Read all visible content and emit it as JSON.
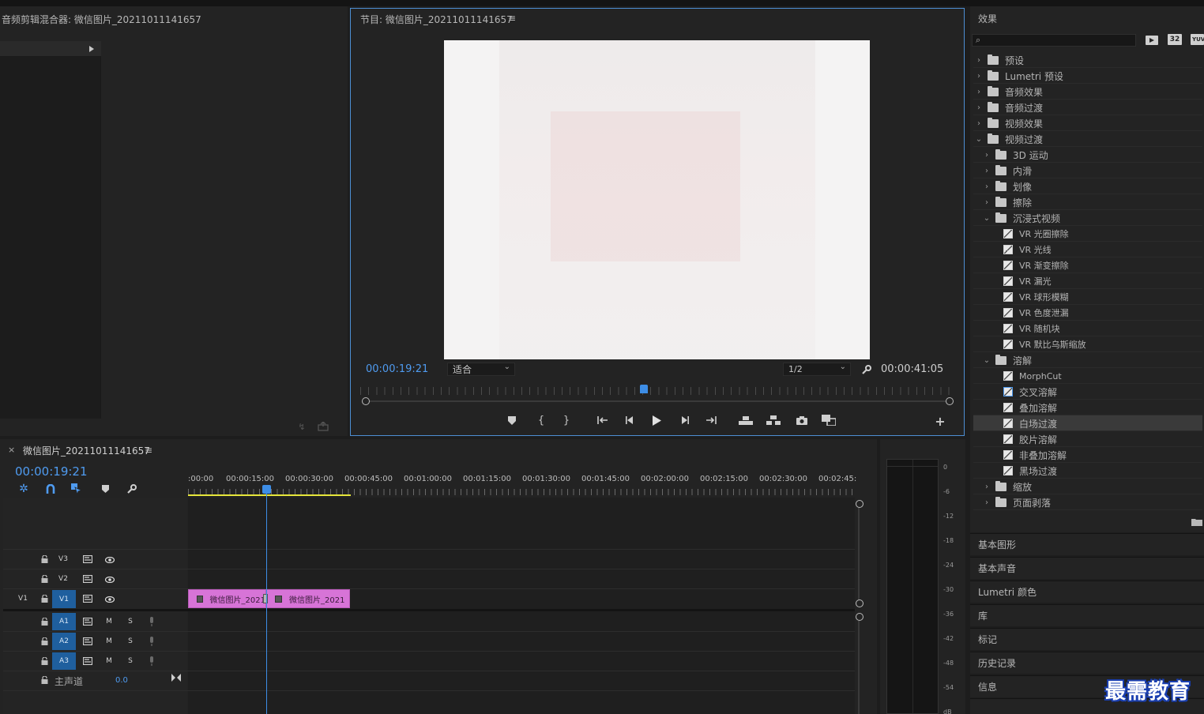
{
  "audio_mixer": {
    "title": "音频剪辑混合器: 微信图片_20211011141657"
  },
  "program": {
    "title": "节目: 微信图片_20211011141657",
    "timecode_current": "00:00:19:21",
    "fit_select": "适合",
    "resolution_select": "1/2",
    "timecode_duration": "00:00:41:05"
  },
  "effects": {
    "title": "效果",
    "search_placeholder": "",
    "badges": [
      "32",
      "YUV"
    ],
    "tree": [
      {
        "label": "预设",
        "kind": "preset",
        "level": 0,
        "chev": "›"
      },
      {
        "label": "Lumetri 预设",
        "kind": "preset",
        "level": 0,
        "chev": "›"
      },
      {
        "label": "音频效果",
        "kind": "folder",
        "level": 0,
        "chev": "›"
      },
      {
        "label": "音频过渡",
        "kind": "folder",
        "level": 0,
        "chev": "›"
      },
      {
        "label": "视频效果",
        "kind": "folder",
        "level": 0,
        "chev": "›"
      },
      {
        "label": "视频过渡",
        "kind": "folder",
        "level": 0,
        "chev": "⌄"
      },
      {
        "label": "3D 运动",
        "kind": "folder",
        "level": 1,
        "chev": "›"
      },
      {
        "label": "内滑",
        "kind": "folder",
        "level": 1,
        "chev": "›"
      },
      {
        "label": "划像",
        "kind": "folder",
        "level": 1,
        "chev": "›"
      },
      {
        "label": "擦除",
        "kind": "folder",
        "level": 1,
        "chev": "›"
      },
      {
        "label": "沉浸式视频",
        "kind": "folder",
        "level": 1,
        "chev": "⌄"
      },
      {
        "label": "VR 光圈擦除",
        "kind": "effect",
        "level": 2,
        "chev": ""
      },
      {
        "label": "VR 光线",
        "kind": "effect",
        "level": 2,
        "chev": ""
      },
      {
        "label": "VR 渐变擦除",
        "kind": "effect",
        "level": 2,
        "chev": ""
      },
      {
        "label": "VR 漏光",
        "kind": "effect",
        "level": 2,
        "chev": ""
      },
      {
        "label": "VR 球形模糊",
        "kind": "effect",
        "level": 2,
        "chev": ""
      },
      {
        "label": "VR 色度泄漏",
        "kind": "effect",
        "level": 2,
        "chev": ""
      },
      {
        "label": "VR 随机块",
        "kind": "effect",
        "level": 2,
        "chev": ""
      },
      {
        "label": "VR 默比乌斯缩放",
        "kind": "effect",
        "level": 2,
        "chev": ""
      },
      {
        "label": "溶解",
        "kind": "folder",
        "level": 1,
        "chev": "⌄"
      },
      {
        "label": "MorphCut",
        "kind": "effect",
        "level": 2,
        "chev": ""
      },
      {
        "label": "交叉溶解",
        "kind": "effect",
        "level": 2,
        "chev": ""
      },
      {
        "label": "叠加溶解",
        "kind": "effect",
        "level": 2,
        "chev": ""
      },
      {
        "label": "白场过渡",
        "kind": "effect",
        "level": 2,
        "chev": "",
        "selected": true
      },
      {
        "label": "胶片溶解",
        "kind": "effect",
        "level": 2,
        "chev": ""
      },
      {
        "label": "非叠加溶解",
        "kind": "effect",
        "level": 2,
        "chev": ""
      },
      {
        "label": "黑场过渡",
        "kind": "effect",
        "level": 2,
        "chev": ""
      },
      {
        "label": "缩放",
        "kind": "folder",
        "level": 1,
        "chev": "›"
      },
      {
        "label": "页面剥落",
        "kind": "folder",
        "level": 1,
        "chev": "›"
      }
    ]
  },
  "side_panels": [
    "基本图形",
    "基本声音",
    "Lumetri 颜色",
    "库",
    "标记",
    "历史记录",
    "信息"
  ],
  "timeline": {
    "tab_close": "×",
    "tab_title": "微信图片_20211011141657",
    "timecode": "00:00:19:21",
    "ruler_labels": [
      ":00:00",
      "00:00:15:00",
      "00:00:30:00",
      "00:00:45:00",
      "00:01:00:00",
      "00:01:15:00",
      "00:01:30:00",
      "00:01:45:00",
      "00:02:00:00",
      "00:02:15:00",
      "00:02:30:00",
      "00:02:45:"
    ],
    "video_tracks": [
      {
        "name": "V3",
        "source": ""
      },
      {
        "name": "V2",
        "source": ""
      },
      {
        "name": "V1",
        "source": "V1"
      }
    ],
    "audio_tracks": [
      {
        "name": "A1",
        "m": "M",
        "s": "S"
      },
      {
        "name": "A2",
        "m": "M",
        "s": "S"
      },
      {
        "name": "A3",
        "m": "M",
        "s": "S"
      }
    ],
    "master": {
      "label": "主声道",
      "value": "0.0"
    },
    "clips": [
      "微信图片_2021",
      "微信图片_2021"
    ]
  },
  "meter": {
    "db_labels": [
      "0",
      "-6",
      "-12",
      "-18",
      "-24",
      "-30",
      "-36",
      "-42",
      "-48",
      "-54",
      "dB"
    ]
  },
  "watermark": "最需教育"
}
